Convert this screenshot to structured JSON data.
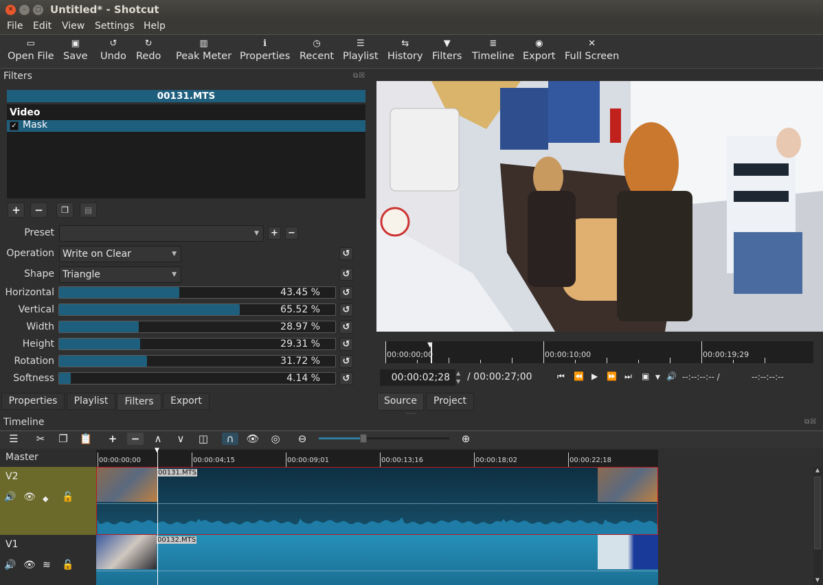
{
  "window": {
    "title": "Untitled* - Shotcut"
  },
  "menu": [
    "File",
    "Edit",
    "View",
    "Settings",
    "Help"
  ],
  "toolbar": [
    {
      "icon": "open-file-icon",
      "label": "Open File"
    },
    {
      "icon": "save-icon",
      "label": "Save"
    },
    {
      "icon": "undo-icon",
      "label": "Undo"
    },
    {
      "icon": "redo-icon",
      "label": "Redo"
    },
    {
      "icon": "peak-meter-icon",
      "label": "Peak Meter"
    },
    {
      "icon": "properties-icon",
      "label": "Properties"
    },
    {
      "icon": "recent-icon",
      "label": "Recent"
    },
    {
      "icon": "playlist-icon",
      "label": "Playlist"
    },
    {
      "icon": "history-icon",
      "label": "History"
    },
    {
      "icon": "filters-icon",
      "label": "Filters"
    },
    {
      "icon": "timeline-icon",
      "label": "Timeline"
    },
    {
      "icon": "export-icon",
      "label": "Export"
    },
    {
      "icon": "full-screen-icon",
      "label": "Full Screen"
    }
  ],
  "filters": {
    "panel_title": "Filters",
    "clip_name": "00131.MTS",
    "group": "Video",
    "items": [
      {
        "name": "Mask",
        "checked": true
      }
    ],
    "preset_label": "Preset",
    "preset_value": "",
    "operation_label": "Operation",
    "operation_value": "Write on Clear",
    "shape_label": "Shape",
    "shape_value": "Triangle",
    "params": [
      {
        "label": "Horizontal",
        "value": 43.45,
        "text": "43.45 %"
      },
      {
        "label": "Vertical",
        "value": 65.52,
        "text": "65.52 %"
      },
      {
        "label": "Width",
        "value": 28.97,
        "text": "28.97 %"
      },
      {
        "label": "Height",
        "value": 29.31,
        "text": "29.31 %"
      },
      {
        "label": "Rotation",
        "value": 31.72,
        "text": "31.72 %"
      },
      {
        "label": "Softness",
        "value": 4.14,
        "text": "4.14 %"
      }
    ]
  },
  "left_tabs": [
    "Properties",
    "Playlist",
    "Filters",
    "Export"
  ],
  "left_tabs_active": "Filters",
  "player": {
    "ruler_labels": [
      "00:00:00;00",
      "00:00:10;00",
      "00:00:19;29"
    ],
    "current_time": "00:00:02;28",
    "total_time": "/ 00:00:27;00",
    "in_point": "--:--:--:-- /",
    "out_point": "--:--:--:--",
    "tabs": [
      "Source",
      "Project"
    ],
    "active_tab": "Source"
  },
  "timeline": {
    "panel_title": "Timeline",
    "master_label": "Master",
    "ruler_labels": [
      "00:00:00;00",
      "00:00:04;15",
      "00:00:09;01",
      "00:00:13;16",
      "00:00:18;02",
      "00:00:22;18"
    ],
    "zoom_level": 0.33,
    "tracks": [
      {
        "name": "V2",
        "clip": "00131.MTS",
        "selected": true
      },
      {
        "name": "V1",
        "clip": "00132.MTS",
        "selected": false
      }
    ]
  },
  "colors": {
    "accent": "#1f5f7e",
    "selected_track": "#6b6a2a",
    "clip_selected_border": "#c0181e"
  }
}
